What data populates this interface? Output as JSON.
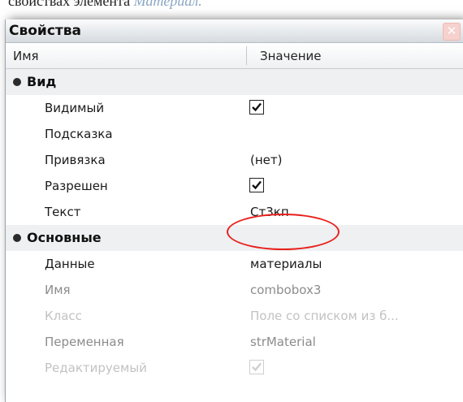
{
  "caption": {
    "text": "свойствах элемента",
    "emphasis": "Материал."
  },
  "panel": {
    "title": "Свойства",
    "close_glyph": "✕"
  },
  "columns": {
    "name": "Имя",
    "value": "Значение"
  },
  "categories": [
    {
      "label": "Вид",
      "rows": [
        {
          "name": "Видимый",
          "checkbox": true,
          "checked": true
        },
        {
          "name": "Подсказка",
          "value": ""
        },
        {
          "name": "Привязка",
          "value": "(нет)"
        },
        {
          "name": "Разрешен",
          "checkbox": true,
          "checked": true
        },
        {
          "name": "Текст",
          "value": "Ст3кп",
          "highlighted": true
        }
      ]
    },
    {
      "label": "Основные",
      "rows": [
        {
          "name": "Данные",
          "value": "материалы"
        },
        {
          "name": "Имя",
          "value": "combobox3"
        },
        {
          "name": "Класс",
          "value": "Поле со списком из б..."
        },
        {
          "name": "Переменная",
          "value": "strMaterial"
        },
        {
          "name": "Редактируемый",
          "checkbox": true,
          "checked": true
        }
      ]
    }
  ],
  "colors": {
    "highlight_ellipse": "#e8201c",
    "category_background": "#eef0f2"
  }
}
